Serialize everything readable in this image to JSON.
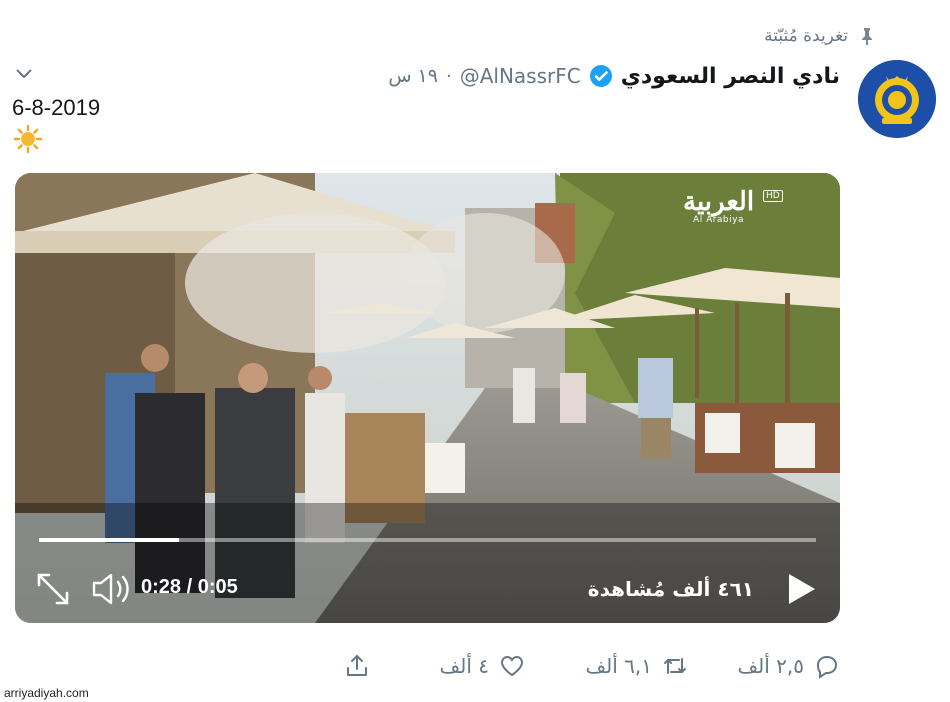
{
  "pinned_label": "تغريدة مُثبّتة",
  "account": {
    "display_name": "نادي النصر السعودي",
    "handle": "@AlNassrFC",
    "separator": "·",
    "timestamp": "١٩ س"
  },
  "tweet": {
    "text": "6-8-2019"
  },
  "video": {
    "watermark_main": "العربية",
    "watermark_sub": "Al Arabiya",
    "watermark_badge": "HD",
    "time": "0:28 / 0:05",
    "views": "٤٦١ ألف مُشاهدة",
    "progress_fraction": 0.18
  },
  "actions": {
    "reply_count": "٢,٥ ألف",
    "retweet_count": "٦,١ ألف",
    "like_count": "٤ ألف"
  },
  "site_credit": "arriyadiyah.com",
  "colors": {
    "secondary_text": "#657786",
    "verified": "#1da1f2",
    "avatar_blue": "#1e4fa8",
    "avatar_gold": "#f2c318"
  }
}
